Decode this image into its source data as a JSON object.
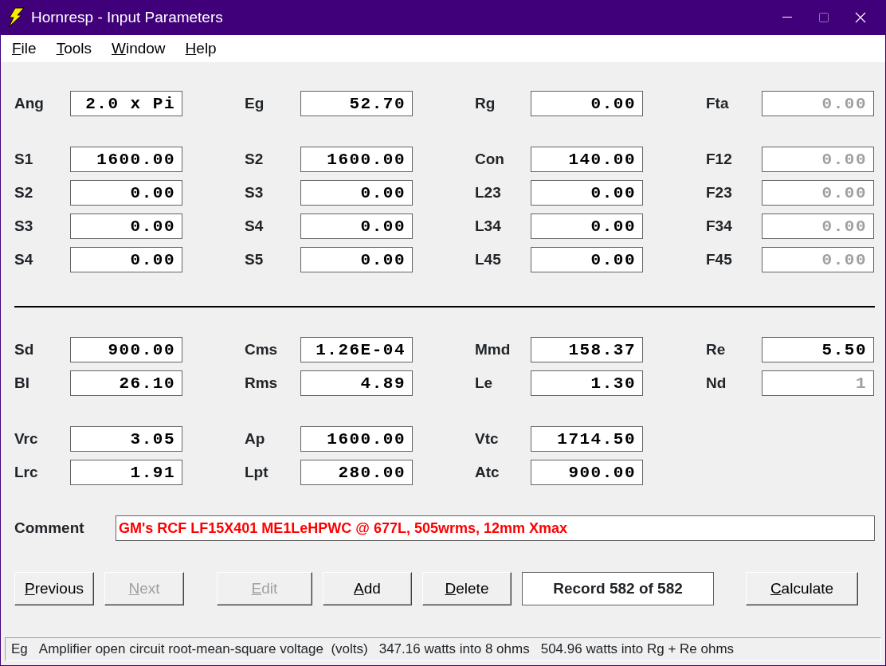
{
  "window": {
    "title": "Hornresp - Input Parameters",
    "maximize_disabled": true
  },
  "menu": [
    "File",
    "Tools",
    "Window",
    "Help"
  ],
  "groups": [
    {
      "kind": "fields",
      "rows": [
        [
          {
            "label": "Ang",
            "value": "2.0 x Pi",
            "disabled": false
          },
          {
            "label": "Eg",
            "value": "52.70",
            "disabled": false
          },
          {
            "label": "Rg",
            "value": "0.00",
            "disabled": false
          },
          {
            "label": "Fta",
            "value": "0.00",
            "disabled": true
          }
        ]
      ]
    },
    {
      "kind": "fields",
      "rows": [
        [
          {
            "label": "S1",
            "value": "1600.00",
            "disabled": false
          },
          {
            "label": "S2",
            "value": "1600.00",
            "disabled": false
          },
          {
            "label": "Con",
            "value": "140.00",
            "disabled": false
          },
          {
            "label": "F12",
            "value": "0.00",
            "disabled": true
          }
        ],
        [
          {
            "label": "S2",
            "value": "0.00",
            "disabled": false
          },
          {
            "label": "S3",
            "value": "0.00",
            "disabled": false
          },
          {
            "label": "L23",
            "value": "0.00",
            "disabled": false
          },
          {
            "label": "F23",
            "value": "0.00",
            "disabled": true
          }
        ],
        [
          {
            "label": "S3",
            "value": "0.00",
            "disabled": false
          },
          {
            "label": "S4",
            "value": "0.00",
            "disabled": false
          },
          {
            "label": "L34",
            "value": "0.00",
            "disabled": false
          },
          {
            "label": "F34",
            "value": "0.00",
            "disabled": true
          }
        ],
        [
          {
            "label": "S4",
            "value": "0.00",
            "disabled": false
          },
          {
            "label": "S5",
            "value": "0.00",
            "disabled": false
          },
          {
            "label": "L45",
            "value": "0.00",
            "disabled": false
          },
          {
            "label": "F45",
            "value": "0.00",
            "disabled": true
          }
        ]
      ]
    },
    {
      "kind": "rule"
    },
    {
      "kind": "fields",
      "rows": [
        [
          {
            "label": "Sd",
            "value": "900.00",
            "disabled": false
          },
          {
            "label": "Cms",
            "value": "1.26E-04",
            "disabled": false
          },
          {
            "label": "Mmd",
            "value": "158.37",
            "disabled": false
          },
          {
            "label": "Re",
            "value": "5.50",
            "disabled": false
          }
        ],
        [
          {
            "label": "Bl",
            "value": "26.10",
            "disabled": false
          },
          {
            "label": "Rms",
            "value": "4.89",
            "disabled": false
          },
          {
            "label": "Le",
            "value": "1.30",
            "disabled": false
          },
          {
            "label": "Nd",
            "value": "1",
            "disabled": true
          }
        ]
      ]
    },
    {
      "kind": "fields",
      "rows": [
        [
          {
            "label": "Vrc",
            "value": "3.05",
            "disabled": false
          },
          {
            "label": "Ap",
            "value": "1600.00",
            "disabled": false
          },
          {
            "label": "Vtc",
            "value": "1714.50",
            "disabled": false
          }
        ],
        [
          {
            "label": "Lrc",
            "value": "1.91",
            "disabled": false
          },
          {
            "label": "Lpt",
            "value": "280.00",
            "disabled": false
          },
          {
            "label": "Atc",
            "value": "900.00",
            "disabled": false
          }
        ]
      ]
    }
  ],
  "comment": {
    "label": "Comment",
    "value": "GM's RCF LF15X401 ME1LeHPWC @ 677L, 505wrms, 12mm Xmax"
  },
  "buttons": [
    {
      "kind": "button",
      "label": "Previous",
      "disabled": false
    },
    {
      "kind": "button",
      "label": "Next",
      "disabled": true
    },
    {
      "kind": "gap"
    },
    {
      "kind": "button",
      "label": "Edit",
      "disabled": true
    },
    {
      "kind": "button",
      "label": "Add",
      "disabled": false
    },
    {
      "kind": "button",
      "label": "Delete",
      "disabled": false
    },
    {
      "kind": "record",
      "label": "Record 582 of 582"
    },
    {
      "kind": "button",
      "label": "Calculate",
      "disabled": false
    }
  ],
  "status_bar": [
    "Eg",
    "Amplifier open circuit root-mean-square voltage  (volts)",
    "347.16 watts into 8 ohms",
    "504.96 watts into Rg + Re ohms"
  ]
}
